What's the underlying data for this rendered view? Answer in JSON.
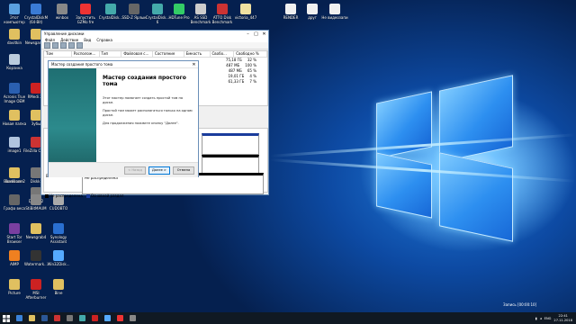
{
  "desktop": {
    "icons": [
      {
        "label": "Этот компьютер",
        "color": "#5aa0e0"
      },
      {
        "label": "CrystalDiskM (64-Bit)",
        "color": "#3a7bd5"
      },
      {
        "label": "winbox",
        "color": "#888"
      },
      {
        "label": "Запустить GZMo fre",
        "color": "#e33"
      },
      {
        "label": "CrystalDisk...",
        "color": "#4aa"
      },
      {
        "label": "SSD-Z Ярлык",
        "color": "#666"
      },
      {
        "label": "CrystalDisk... 6",
        "color": "#4aa"
      },
      {
        "label": "HDTune Pro",
        "color": "#3c6"
      },
      {
        "label": "AS SSD Benchmark",
        "color": "#ccc"
      },
      {
        "label": "ATTO Disk Benchmark",
        "color": "#c33"
      },
      {
        "label": "victoria_447",
        "color": "#f0e0a0"
      },
      {
        "label": "RENDER",
        "color": "#f0f0f0"
      },
      {
        "label": "друг",
        "color": "#f0f0f0"
      },
      {
        "label": "Не видеозапи",
        "color": "#f0f0f0"
      },
      {
        "label": "davitkin",
        "color": "#e0c060"
      },
      {
        "label": "Newsgames",
        "color": "#e0c060"
      },
      {
        "label": "Корзина",
        "color": "#bcd"
      },
      {
        "label": "Acronis True Image OEM",
        "color": "#2a5fb0"
      },
      {
        "label": "RMedi 22",
        "color": "#c22"
      },
      {
        "label": "Новая папка",
        "color": "#e0c060"
      },
      {
        "label": "Зубы",
        "color": "#e0c060"
      },
      {
        "label": "image1",
        "color": "#b0c4de"
      },
      {
        "label": "FileZilla Client",
        "color": "#c33"
      },
      {
        "label": "Bandicam",
        "color": "#333"
      },
      {
        "label": "Diskkr",
        "color": "#777"
      },
      {
        "label": "Bandicam 2",
        "color": "#e0c060"
      },
      {
        "label": "Diskkr 2",
        "color": "#777"
      },
      {
        "label": "Графа веса",
        "color": "#666"
      },
      {
        "label": "StiBitMAUM",
        "color": "#888"
      },
      {
        "label": "CUDOBTO",
        "color": "#aaa"
      },
      {
        "label": "Start Tor Browser",
        "color": "#7a3fa0"
      },
      {
        "label": "Newsgrab4",
        "color": "#e0c060"
      },
      {
        "label": "Synology Assistant",
        "color": "#2a6fd0"
      },
      {
        "label": "AIMP",
        "color": "#f08020"
      },
      {
        "label": "Watermark...",
        "color": "#333"
      },
      {
        "label": "Win32Disk...",
        "color": "#5af"
      },
      {
        "label": "Picture",
        "color": "#e0c060"
      },
      {
        "label": "MSI Afterburner",
        "color": "#c22"
      },
      {
        "label": "Вine",
        "color": "#e0c060"
      }
    ]
  },
  "disk_mgmt": {
    "title": "Управление дисками",
    "menu": [
      "Файл",
      "Действие",
      "Вид",
      "Справка"
    ],
    "columns": [
      "Том",
      "Располож...",
      "Тип",
      "Файловая с...",
      "Состояние",
      "Емкость",
      "Свобо...",
      "Свободно %"
    ],
    "rows": [
      {
        "free": "75,18 ГБ",
        "pct": "32 %"
      },
      {
        "free": "487 МБ",
        "pct": "100 %"
      },
      {
        "free": "487 МБ",
        "pct": "65 %"
      },
      {
        "free": "19,01 ГБ",
        "pct": "4 %"
      },
      {
        "free": "61,33 ГБ",
        "pct": "7 %"
      }
    ],
    "disk_row_1": "В сети",
    "disk_row_2": "Не распределена",
    "legend_unalloc": "Не распределена",
    "legend_primary": "Основной раздел"
  },
  "wizard": {
    "title": "Мастер создания простого тома",
    "heading": "Мастер создания простого тома",
    "text1": "Этот мастер помогает создать простой том на диске.",
    "text2": "Простой том может располагаться только на одном диске.",
    "text3": "Для продолжения нажмите кнопку \"Далее\".",
    "back": "< Назад",
    "next": "Далее >",
    "cancel": "Отмена"
  },
  "taskbar": {
    "tray_lang": "ENG",
    "time": "22:41",
    "date": "27.11.2018",
    "recording": "Запись [00:00:10]"
  }
}
